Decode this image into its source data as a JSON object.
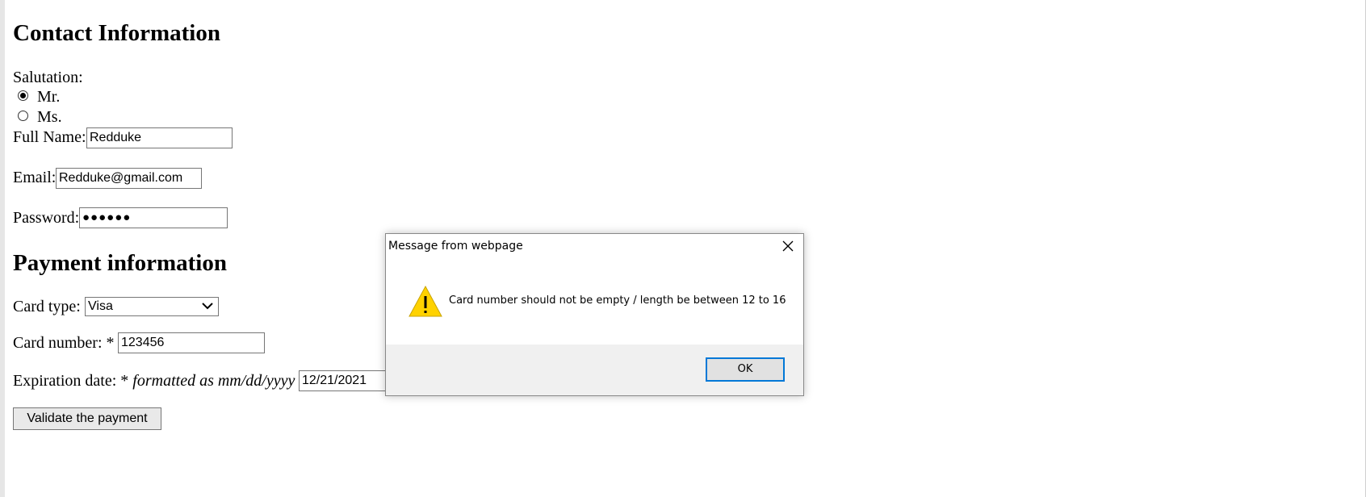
{
  "contact": {
    "heading": "Contact Information",
    "salutation_label": "Salutation:",
    "salutation_options": [
      "Mr.",
      "Ms."
    ],
    "salutation_selected": "Mr.",
    "full_name_label": "Full Name:",
    "full_name_value": "Redduke",
    "email_label": "Email:",
    "email_value": "Redduke@gmail.com",
    "password_label": "Password:",
    "password_value": "●●●●●●"
  },
  "payment": {
    "heading": "Payment information",
    "card_type_label": "Card type:",
    "card_type_value": "Visa",
    "card_number_label": "Card number: *",
    "card_number_value": "123456",
    "expiration_label_prefix": "Expiration date: *",
    "expiration_label_hint": "formatted as mm/dd/yyyy",
    "expiration_value": "12/21/2021",
    "validate_button": "Validate the payment"
  },
  "dialog": {
    "title": "Message from webpage",
    "message": "Card number should not be empty / length be between 12 to 16",
    "ok_label": "OK",
    "icon": "warning-icon",
    "close_icon": "close-icon",
    "footer_color": "#f0f0f0",
    "ok_border_color": "#0078d7"
  }
}
